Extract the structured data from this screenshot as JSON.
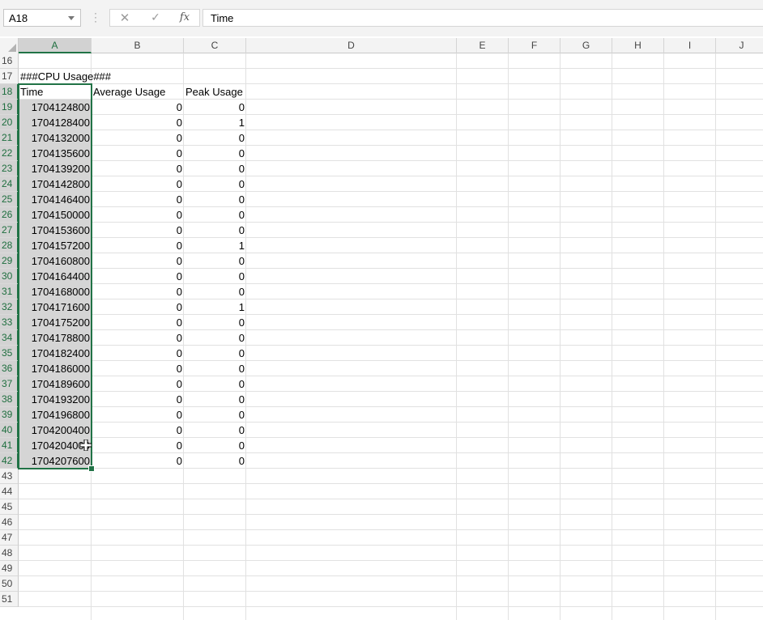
{
  "formula_bar": {
    "name_box": "A18",
    "formula": "Time"
  },
  "sheet": {
    "columns": [
      "A",
      "B",
      "C",
      "D",
      "E",
      "F",
      "G",
      "H",
      "I",
      "J"
    ],
    "rows": [
      16,
      17,
      18,
      19,
      20,
      21,
      22,
      23,
      24,
      25,
      26,
      27,
      28,
      29,
      30,
      31,
      32,
      33,
      34,
      35,
      36,
      37,
      38,
      39,
      40,
      41,
      42,
      43,
      44,
      45,
      46,
      47,
      48,
      49,
      50,
      51
    ],
    "heading": "###CPU Usage###",
    "headers": [
      "Time",
      "Average Usage",
      "Peak Usage"
    ],
    "data": [
      [
        "1704124800",
        "0",
        "0"
      ],
      [
        "1704128400",
        "0",
        "1"
      ],
      [
        "1704132000",
        "0",
        "0"
      ],
      [
        "1704135600",
        "0",
        "0"
      ],
      [
        "1704139200",
        "0",
        "0"
      ],
      [
        "1704142800",
        "0",
        "0"
      ],
      [
        "1704146400",
        "0",
        "0"
      ],
      [
        "1704150000",
        "0",
        "0"
      ],
      [
        "1704153600",
        "0",
        "0"
      ],
      [
        "1704157200",
        "0",
        "1"
      ],
      [
        "1704160800",
        "0",
        "0"
      ],
      [
        "1704164400",
        "0",
        "0"
      ],
      [
        "1704168000",
        "0",
        "0"
      ],
      [
        "1704171600",
        "0",
        "1"
      ],
      [
        "1704175200",
        "0",
        "0"
      ],
      [
        "1704178800",
        "0",
        "0"
      ],
      [
        "1704182400",
        "0",
        "0"
      ],
      [
        "1704186000",
        "0",
        "0"
      ],
      [
        "1704189600",
        "0",
        "0"
      ],
      [
        "1704193200",
        "0",
        "0"
      ],
      [
        "1704196800",
        "0",
        "0"
      ],
      [
        "1704200400",
        "0",
        "0"
      ],
      [
        "1704204000",
        "0",
        "0"
      ],
      [
        "1704207600",
        "0",
        "0"
      ]
    ],
    "selected_column": "A",
    "selected_rows": [
      18,
      42
    ]
  },
  "icons": {
    "cancel": "close-icon",
    "enter": "check-icon",
    "function": "fx-icon",
    "cursor": "cell-select-cross-icon"
  },
  "colors": {
    "selection": "#217346"
  }
}
